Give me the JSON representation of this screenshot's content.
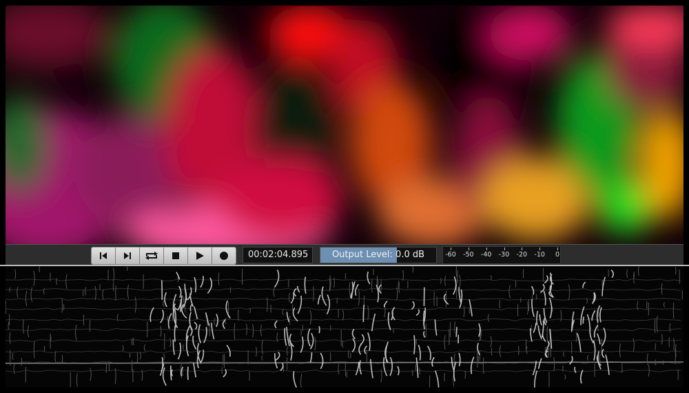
{
  "transport": {
    "buttons": [
      {
        "name": "skip-to-start-button",
        "icon": "skip-back-icon"
      },
      {
        "name": "skip-to-end-button",
        "icon": "skip-forward-icon"
      },
      {
        "name": "loop-button",
        "icon": "loop-icon"
      },
      {
        "name": "stop-button",
        "icon": "stop-icon"
      },
      {
        "name": "play-button",
        "icon": "play-icon"
      },
      {
        "name": "record-button",
        "icon": "record-icon"
      }
    ]
  },
  "time": {
    "display": "00:02:04.895"
  },
  "output_level": {
    "label": "Output Level: 0.0 dB",
    "fill_fraction": 0.66
  },
  "meter": {
    "ticks": [
      "-60",
      "-50",
      "-40",
      "-30",
      "-20",
      "-10",
      "0"
    ]
  },
  "colors": {
    "toolbar": "#2d2d2d",
    "level_fill": "#6d8fb2",
    "button": "#d4d4d4"
  }
}
